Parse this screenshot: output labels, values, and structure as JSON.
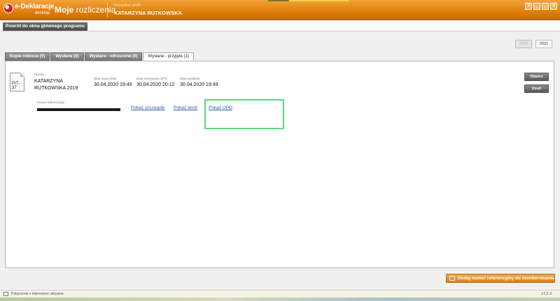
{
  "header": {
    "logo_text": "e-Deklaracje",
    "logo_sub": "desktop",
    "title_bold": "Moje",
    "title_rest": " rozliczenia",
    "profile_label": "Domyślny profil",
    "profile_name": "KATARZYNA RUTKOWSKA",
    "window_buttons": [
      "?",
      "_",
      "□",
      "×"
    ]
  },
  "nav": {
    "back_label": "Powrót do okna głównego programu"
  },
  "years": [
    "2020",
    "2021"
  ],
  "tabs": [
    {
      "label": "Kopie robocze (0)",
      "active": false
    },
    {
      "label": "Wysłane (0)",
      "active": false
    },
    {
      "label": "Wysłane - odrzucone (0)",
      "active": false
    },
    {
      "label": "Wysłane - przyjęte (1)",
      "active": true
    }
  ],
  "document": {
    "form_code": "PIT-37",
    "name_label": "Nazwa",
    "name_line1": "KATARZYNA",
    "name_line2": "RUTKOWSKA 2019",
    "created_label": "Data utworzenia",
    "created_value": "30.04.2020 19:49",
    "upo_date_label": "Data otrzymania UPO",
    "upo_date_value": "30.04.2020 20:12",
    "sent_label": "Data wysłania",
    "sent_value": "30.04.2020 19:49",
    "ref_label": "Numer referencyjny"
  },
  "links": {
    "details": "Pokaż szczegóły",
    "summary": "Pokaż skrót",
    "upo": "Pokaż UPO"
  },
  "actions": {
    "open": "Otwórz",
    "delete": "Usuń"
  },
  "footer": {
    "add_ref_label": "Dodaj numer referencyjny do monitorowania",
    "status_text": "Połączenie z Internetem: aktywne",
    "version": "17.2.3"
  },
  "colors": {
    "header": "#e07f0a",
    "highlight": "#5ad87a",
    "link": "#2a5d9f",
    "add_button": "#d98318"
  }
}
